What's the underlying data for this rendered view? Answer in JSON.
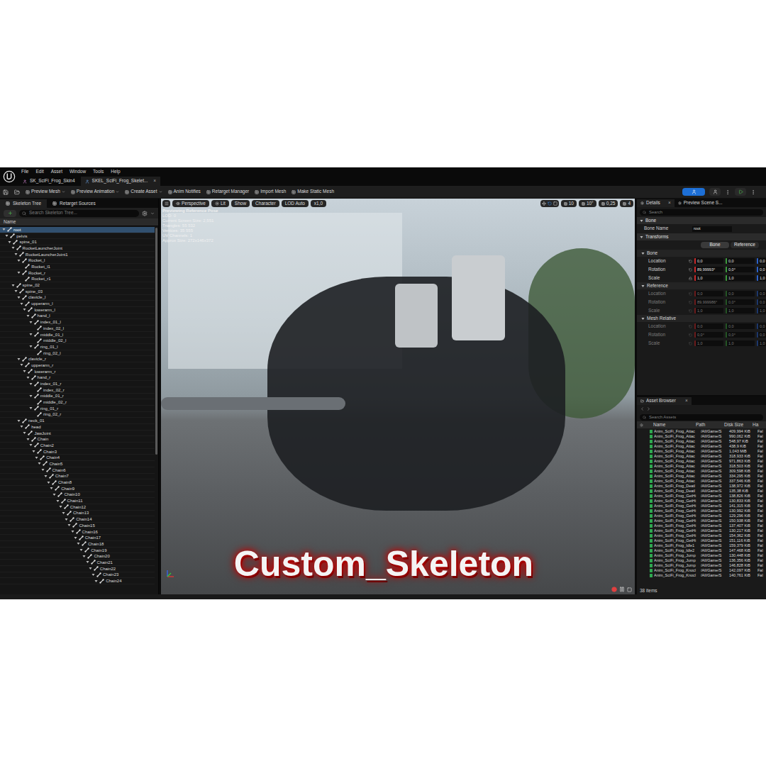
{
  "menu": [
    "File",
    "Edit",
    "Asset",
    "Window",
    "Tools",
    "Help"
  ],
  "doc_tabs": [
    {
      "label": "SK_SciFi_Frog_Skin4",
      "selected": false
    },
    {
      "label": "SKEL_SciFi_Frog_Skelet...",
      "selected": true,
      "close": "×"
    }
  ],
  "toolbar": [
    "Preview Mesh",
    "Preview Animation",
    "Create Asset",
    "Anim Notifies",
    "Retarget Manager",
    "Import Mesh",
    "Make Static Mesh"
  ],
  "skeleton_panel": {
    "tabs": [
      {
        "label": "Skeleton Tree",
        "selected": true
      },
      {
        "label": "Retarget Sources",
        "selected": false
      }
    ],
    "search_placeholder": "Search Skeleton Tree...",
    "header": "Name",
    "bones": [
      {
        "name": "root",
        "depth": 0,
        "expanded": true,
        "selected": true
      },
      {
        "name": "pelvis",
        "depth": 1,
        "expanded": true,
        "selected": false
      },
      {
        "name": "spine_01",
        "depth": 2,
        "expanded": true,
        "selected": false
      },
      {
        "name": "RocketLauncherJoint",
        "depth": 3,
        "expanded": true,
        "selected": false
      },
      {
        "name": "RocketLauncherJoint1",
        "depth": 4,
        "expanded": true,
        "selected": false
      },
      {
        "name": "Rocket_l",
        "depth": 5,
        "expanded": true,
        "selected": false
      },
      {
        "name": "Rocket_l1",
        "depth": 6,
        "expanded": false,
        "selected": false
      },
      {
        "name": "Rocket_r",
        "depth": 5,
        "expanded": true,
        "selected": false
      },
      {
        "name": "Rocket_r1",
        "depth": 6,
        "expanded": false,
        "selected": false
      },
      {
        "name": "spine_02",
        "depth": 3,
        "expanded": true,
        "selected": false
      },
      {
        "name": "spine_03",
        "depth": 4,
        "expanded": true,
        "selected": false
      },
      {
        "name": "clavicle_l",
        "depth": 5,
        "expanded": true,
        "selected": false
      },
      {
        "name": "upperarm_l",
        "depth": 6,
        "expanded": true,
        "selected": false
      },
      {
        "name": "lowerarm_l",
        "depth": 7,
        "expanded": true,
        "selected": false
      },
      {
        "name": "hand_l",
        "depth": 8,
        "expanded": true,
        "selected": false
      },
      {
        "name": "index_01_l",
        "depth": 9,
        "expanded": true,
        "selected": false
      },
      {
        "name": "index_02_l",
        "depth": 10,
        "expanded": false,
        "selected": false
      },
      {
        "name": "middle_01_l",
        "depth": 9,
        "expanded": true,
        "selected": false
      },
      {
        "name": "middle_02_l",
        "depth": 10,
        "expanded": false,
        "selected": false
      },
      {
        "name": "ring_01_l",
        "depth": 9,
        "expanded": true,
        "selected": false
      },
      {
        "name": "ring_02_l",
        "depth": 10,
        "expanded": false,
        "selected": false
      },
      {
        "name": "clavicle_r",
        "depth": 5,
        "expanded": true,
        "selected": false
      },
      {
        "name": "upperarm_r",
        "depth": 6,
        "expanded": true,
        "selected": false
      },
      {
        "name": "lowerarm_r",
        "depth": 7,
        "expanded": true,
        "selected": false
      },
      {
        "name": "hand_r",
        "depth": 8,
        "expanded": true,
        "selected": false
      },
      {
        "name": "index_01_r",
        "depth": 9,
        "expanded": true,
        "selected": false
      },
      {
        "name": "index_02_r",
        "depth": 10,
        "expanded": false,
        "selected": false
      },
      {
        "name": "middle_01_r",
        "depth": 9,
        "expanded": true,
        "selected": false
      },
      {
        "name": "middle_02_r",
        "depth": 10,
        "expanded": false,
        "selected": false
      },
      {
        "name": "ring_01_r",
        "depth": 9,
        "expanded": true,
        "selected": false
      },
      {
        "name": "ring_02_r",
        "depth": 10,
        "expanded": false,
        "selected": false
      },
      {
        "name": "neck_01",
        "depth": 5,
        "expanded": true,
        "selected": false
      },
      {
        "name": "head",
        "depth": 6,
        "expanded": true,
        "selected": false
      },
      {
        "name": "JawJoint",
        "depth": 7,
        "expanded": true,
        "selected": false
      },
      {
        "name": "Chain",
        "depth": 8,
        "expanded": true,
        "selected": false
      },
      {
        "name": "Chain2",
        "depth": 9,
        "expanded": true,
        "selected": false
      },
      {
        "name": "Chain3",
        "depth": 10,
        "expanded": true,
        "selected": false
      },
      {
        "name": "Chain4",
        "depth": 11,
        "expanded": true,
        "selected": false
      },
      {
        "name": "Chain5",
        "depth": 12,
        "expanded": true,
        "selected": false
      },
      {
        "name": "Chain6",
        "depth": 13,
        "expanded": true,
        "selected": false
      },
      {
        "name": "Chain7",
        "depth": 14,
        "expanded": true,
        "selected": false
      },
      {
        "name": "Chain8",
        "depth": 15,
        "expanded": true,
        "selected": false
      },
      {
        "name": "Chain9",
        "depth": 16,
        "expanded": true,
        "selected": false
      },
      {
        "name": "Chain10",
        "depth": 17,
        "expanded": true,
        "selected": false
      },
      {
        "name": "Chain11",
        "depth": 18,
        "expanded": true,
        "selected": false
      },
      {
        "name": "Chain12",
        "depth": 19,
        "expanded": true,
        "selected": false
      },
      {
        "name": "Chain13",
        "depth": 20,
        "expanded": true,
        "selected": false
      },
      {
        "name": "Chain14",
        "depth": 21,
        "expanded": true,
        "selected": false
      },
      {
        "name": "Chain15",
        "depth": 22,
        "expanded": true,
        "selected": false
      },
      {
        "name": "Chain16",
        "depth": 23,
        "expanded": true,
        "selected": false
      },
      {
        "name": "Chain17",
        "depth": 24,
        "expanded": true,
        "selected": false
      },
      {
        "name": "Chain18",
        "depth": 25,
        "expanded": true,
        "selected": false
      },
      {
        "name": "Chain19",
        "depth": 26,
        "expanded": true,
        "selected": false
      },
      {
        "name": "Chain20",
        "depth": 27,
        "expanded": true,
        "selected": false
      },
      {
        "name": "Chain21",
        "depth": 28,
        "expanded": true,
        "selected": false
      },
      {
        "name": "Chain22",
        "depth": 29,
        "expanded": true,
        "selected": false
      },
      {
        "name": "Chain23",
        "depth": 30,
        "expanded": true,
        "selected": false
      },
      {
        "name": "Chain24",
        "depth": 31,
        "expanded": true,
        "selected": false
      }
    ]
  },
  "viewport": {
    "toolbar_left": [
      "Perspective",
      "Lit",
      "Show",
      "Character",
      "LOD Auto",
      "x1,0"
    ],
    "toolbar_right": [
      "10",
      "10°",
      "0,25",
      "4"
    ],
    "overlay": [
      "Previewing Reference Pose",
      "LOD: 0",
      "Current Screen Size: 2,551",
      "Triangles: 55 532",
      "Vertices: 35 555",
      "UV Channels: 1",
      "Approx Size: 272x146x372"
    ],
    "caption": "Custom_Skeleton"
  },
  "details": {
    "tabs": [
      {
        "label": "Details",
        "selected": true,
        "close": "×"
      },
      {
        "label": "Preview Scene S...",
        "selected": false
      }
    ],
    "search_placeholder": "Search",
    "bone_section": "Bone",
    "bone_name_label": "Bone Name",
    "bone_name": "root",
    "transforms_section": "Transforms",
    "mode_buttons": [
      {
        "label": "Bone",
        "selected": true
      },
      {
        "label": "Reference",
        "selected": false
      }
    ],
    "groups": [
      {
        "title": "Bone",
        "disabled": false,
        "rows": [
          {
            "label": "Location",
            "values": [
              "0,0",
              "0,0",
              "0,0"
            ]
          },
          {
            "label": "Rotation",
            "values": [
              "89,99993°",
              "0,0°",
              "0,0"
            ]
          },
          {
            "label": "Scale",
            "values": [
              "1,0",
              "1,0",
              "1,0"
            ]
          }
        ]
      },
      {
        "title": "Reference",
        "disabled": true,
        "rows": [
          {
            "label": "Location",
            "values": [
              "0,0",
              "0,0",
              "0,0"
            ]
          },
          {
            "label": "Rotation",
            "values": [
              "89,999986°",
              "0,0°",
              "0,0"
            ]
          },
          {
            "label": "Scale",
            "values": [
              "1,0",
              "1,0",
              "1,0"
            ]
          }
        ]
      },
      {
        "title": "Mesh Relative",
        "disabled": true,
        "rows": [
          {
            "label": "Location",
            "values": [
              "0,0",
              "0,0",
              "0,0"
            ]
          },
          {
            "label": "Rotation",
            "values": [
              "0,0°",
              "0,0°",
              "0,0"
            ]
          },
          {
            "label": "Scale",
            "values": [
              "1,0",
              "1,0",
              "1,0"
            ]
          }
        ]
      }
    ]
  },
  "asset_browser": {
    "tab": "Asset Browser",
    "close": "×",
    "search_placeholder": "Search Assets",
    "columns": [
      "Name",
      "Path",
      "Disk Size",
      "Ha"
    ],
    "count": "38 items",
    "rows": [
      {
        "name": "Anim_SciFi_Frog_Attac",
        "path": "/All/Game/S",
        "size": "409,994 KiB",
        "flag": "Fal"
      },
      {
        "name": "Anim_SciFi_Frog_Attac",
        "path": "/All/Game/S",
        "size": "990,062 KiB",
        "flag": "Fal"
      },
      {
        "name": "Anim_SciFi_Frog_Attac",
        "path": "/All/Game/S",
        "size": "548,97 KiB",
        "flag": "Fal"
      },
      {
        "name": "Anim_SciFi_Frog_Attac",
        "path": "/All/Game/S",
        "size": "438,9 KiB",
        "flag": "Fal"
      },
      {
        "name": "Anim_SciFi_Frog_Attac",
        "path": "/All/Game/S",
        "size": "1,043 MiB",
        "flag": "Fal"
      },
      {
        "name": "Anim_SciFi_Frog_Attac",
        "path": "/All/Game/S",
        "size": "318,933 KiB",
        "flag": "Fal"
      },
      {
        "name": "Anim_SciFi_Frog_Attac",
        "path": "/All/Game/S",
        "size": "971,863 KiB",
        "flag": "Fal"
      },
      {
        "name": "Anim_SciFi_Frog_Attac",
        "path": "/All/Game/S",
        "size": "318,503 KiB",
        "flag": "Fal"
      },
      {
        "name": "Anim_SciFi_Frog_Attac",
        "path": "/All/Game/S",
        "size": "309,598 KiB",
        "flag": "Fal"
      },
      {
        "name": "Anim_SciFi_Frog_Attac",
        "path": "/All/Game/S",
        "size": "334,295 KiB",
        "flag": "Fal"
      },
      {
        "name": "Anim_SciFi_Frog_Attac",
        "path": "/All/Game/S",
        "size": "337,546 KiB",
        "flag": "Fal"
      },
      {
        "name": "Anim_SciFi_Frog_Deatl",
        "path": "/All/Game/S",
        "size": "138,972 KiB",
        "flag": "Fal"
      },
      {
        "name": "Anim_SciFi_Frog_Deatl",
        "path": "/All/Game/S",
        "size": "135,38 KiB",
        "flag": "Fal"
      },
      {
        "name": "Anim_SciFi_Frog_GetHi",
        "path": "/All/Game/S",
        "size": "138,826 KiB",
        "flag": "Fal"
      },
      {
        "name": "Anim_SciFi_Frog_GetHi",
        "path": "/All/Game/S",
        "size": "130,833 KiB",
        "flag": "Fal"
      },
      {
        "name": "Anim_SciFi_Frog_GetHi",
        "path": "/All/Game/S",
        "size": "141,315 KiB",
        "flag": "Fal"
      },
      {
        "name": "Anim_SciFi_Frog_GetHi",
        "path": "/All/Game/S",
        "size": "130,992 KiB",
        "flag": "Fal"
      },
      {
        "name": "Anim_SciFi_Frog_GetHi",
        "path": "/All/Game/S",
        "size": "129,296 KiB",
        "flag": "Fal"
      },
      {
        "name": "Anim_SciFi_Frog_GetHi",
        "path": "/All/Game/S",
        "size": "150,938 KiB",
        "flag": "Fal"
      },
      {
        "name": "Anim_SciFi_Frog_GetHi",
        "path": "/All/Game/S",
        "size": "137,407 KiB",
        "flag": "Fal"
      },
      {
        "name": "Anim_SciFi_Frog_GetHi",
        "path": "/All/Game/S",
        "size": "130,217 KiB",
        "flag": "Fal"
      },
      {
        "name": "Anim_SciFi_Frog_GetHi",
        "path": "/All/Game/S",
        "size": "154,362 KiB",
        "flag": "Fal"
      },
      {
        "name": "Anim_SciFi_Frog_GetHi",
        "path": "/All/Game/S",
        "size": "151,116 KiB",
        "flag": "Fal"
      },
      {
        "name": "Anim_SciFi_Frog_Idle1",
        "path": "/All/Game/S",
        "size": "159,379 KiB",
        "flag": "Fal"
      },
      {
        "name": "Anim_SciFi_Frog_Idle2",
        "path": "/All/Game/S",
        "size": "147,468 KiB",
        "flag": "Fal"
      },
      {
        "name": "Anim_SciFi_Frog_Jump",
        "path": "/All/Game/S",
        "size": "130,448 KiB",
        "flag": "Fal"
      },
      {
        "name": "Anim_SciFi_Frog_Jump",
        "path": "/All/Game/S",
        "size": "136,356 KiB",
        "flag": "Fal"
      },
      {
        "name": "Anim_SciFi_Frog_Jump",
        "path": "/All/Game/S",
        "size": "146,828 KiB",
        "flag": "Fal"
      },
      {
        "name": "Anim_SciFi_Frog_Knocl",
        "path": "/All/Game/S",
        "size": "142,097 KiB",
        "flag": "Fal"
      },
      {
        "name": "Anim_SciFi_Frog_Knocl",
        "path": "/All/Game/S",
        "size": "140,761 KiB",
        "flag": "Fal"
      }
    ]
  }
}
